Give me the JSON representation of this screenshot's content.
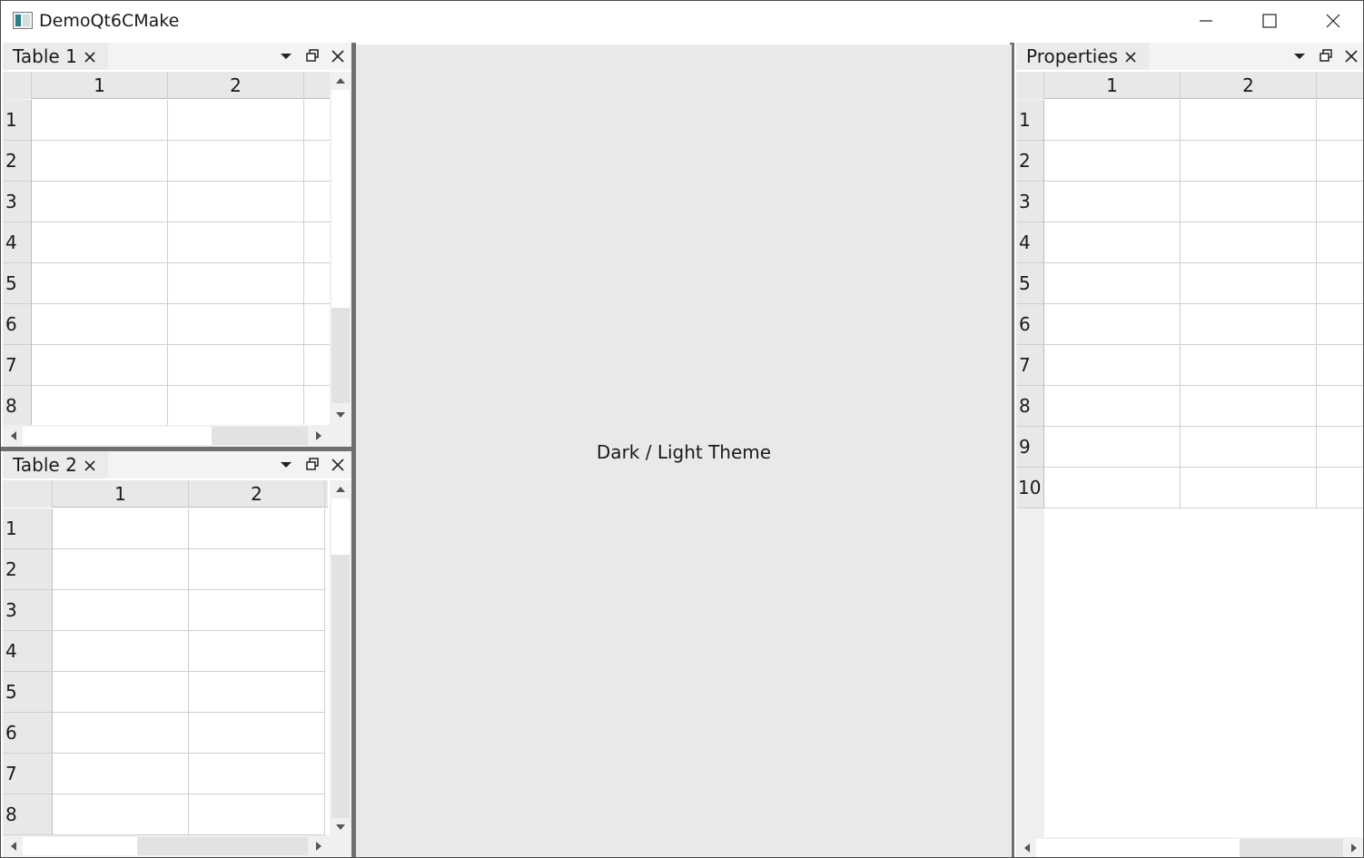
{
  "window": {
    "title": "DemoQt6CMake"
  },
  "central": {
    "label": "Dark / Light Theme"
  },
  "docks": {
    "table1": {
      "title": "Table 1",
      "columns": [
        "1",
        "2"
      ],
      "rows": [
        "1",
        "2",
        "3",
        "4",
        "5",
        "6",
        "7",
        "8"
      ]
    },
    "table2": {
      "title": "Table 2",
      "columns": [
        "1",
        "2"
      ],
      "rows": [
        "1",
        "2",
        "3",
        "4",
        "5",
        "6",
        "7",
        "8"
      ]
    },
    "properties": {
      "title": "Properties",
      "columns": [
        "1",
        "2"
      ],
      "rows": [
        "1",
        "2",
        "3",
        "4",
        "5",
        "6",
        "7",
        "8",
        "9",
        "10"
      ]
    }
  },
  "icons": {
    "tab_close": "close-icon",
    "dock_menu": "chevron-down-icon",
    "dock_float": "float-window-icon",
    "dock_close": "close-icon"
  },
  "colors": {
    "header_bg": "#e8e8e8",
    "splitter": "#6f6f6f",
    "central_bg": "#e9e9e9"
  }
}
